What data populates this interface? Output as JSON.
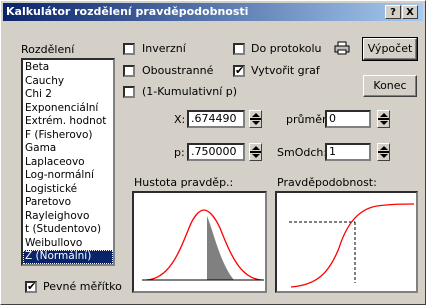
{
  "window": {
    "title": "Kalkulátor rozdělení pravděpodobnosti",
    "help_label": "?",
    "close_label": "X"
  },
  "distribution": {
    "label": "Rozdělení",
    "items": [
      "Beta",
      "Cauchy",
      "Chi 2",
      "Exponenciální",
      "Extrém. hodnot",
      "F (Fisherovo)",
      "Gama",
      "Laplaceovo",
      "Log-normální",
      "Logistické",
      "Paretovo",
      "Rayleighovo",
      "t (Studentovo)",
      "Weibullovo",
      "Z (Normální)"
    ],
    "selected": "Z (Normální)"
  },
  "options": {
    "inverse": {
      "label": "Inverzní",
      "checked": false
    },
    "two_sided": {
      "label": "Oboustranné",
      "checked": false
    },
    "one_minus": {
      "label": "(1-Kumulativní p)",
      "checked": false
    },
    "to_report": {
      "label": "Do protokolu",
      "checked": false
    },
    "create_graph": {
      "label": "Vytvořit graf",
      "checked": true
    },
    "fixed_scale": {
      "label": "Pevné měřítko",
      "checked": true
    }
  },
  "buttons": {
    "compute": "Výpočet",
    "end": "Konec"
  },
  "inputs": {
    "x": {
      "label": "X:",
      "value": ".674490"
    },
    "p": {
      "label": "p:",
      "value": ".750000"
    },
    "mean": {
      "label": "průměr:",
      "value": "0"
    },
    "sd": {
      "label": "SmOdch:",
      "value": "1"
    }
  },
  "graphs": {
    "density_title": "Hustota pravděp.:",
    "cumulative_title": "Pravděpodobnost:"
  },
  "colors": {
    "curve": "#ff0000",
    "fill": "#808080",
    "selection": "#0a246a"
  }
}
